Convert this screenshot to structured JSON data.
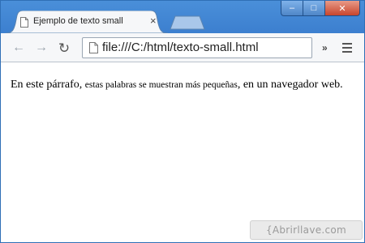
{
  "window": {
    "tab_title": "Ejemplo de texto small",
    "tab_close_symbol": "×",
    "controls": {
      "minimize": "–",
      "maximize": "□",
      "close": "✕"
    }
  },
  "toolbar": {
    "back_symbol": "←",
    "forward_symbol": "→",
    "reload_symbol": "↻",
    "url": "file:///C:/html/texto-small.html",
    "chevron_symbol": "»"
  },
  "content": {
    "text_before": "En este párrafo, ",
    "text_small": "estas palabras se muestran más pequeñas",
    "text_after": ", en un navegador web."
  },
  "watermark": {
    "text": "{Abrirllave.com"
  },
  "colors": {
    "frame": "#4a8fd9",
    "toolbar": "#f6f7f9",
    "close_button": "#c8452c"
  },
  "icons": [
    "document-icon",
    "back-arrow-icon",
    "forward-arrow-icon",
    "reload-icon",
    "page-icon",
    "chevron-icon",
    "menu-icon"
  ]
}
